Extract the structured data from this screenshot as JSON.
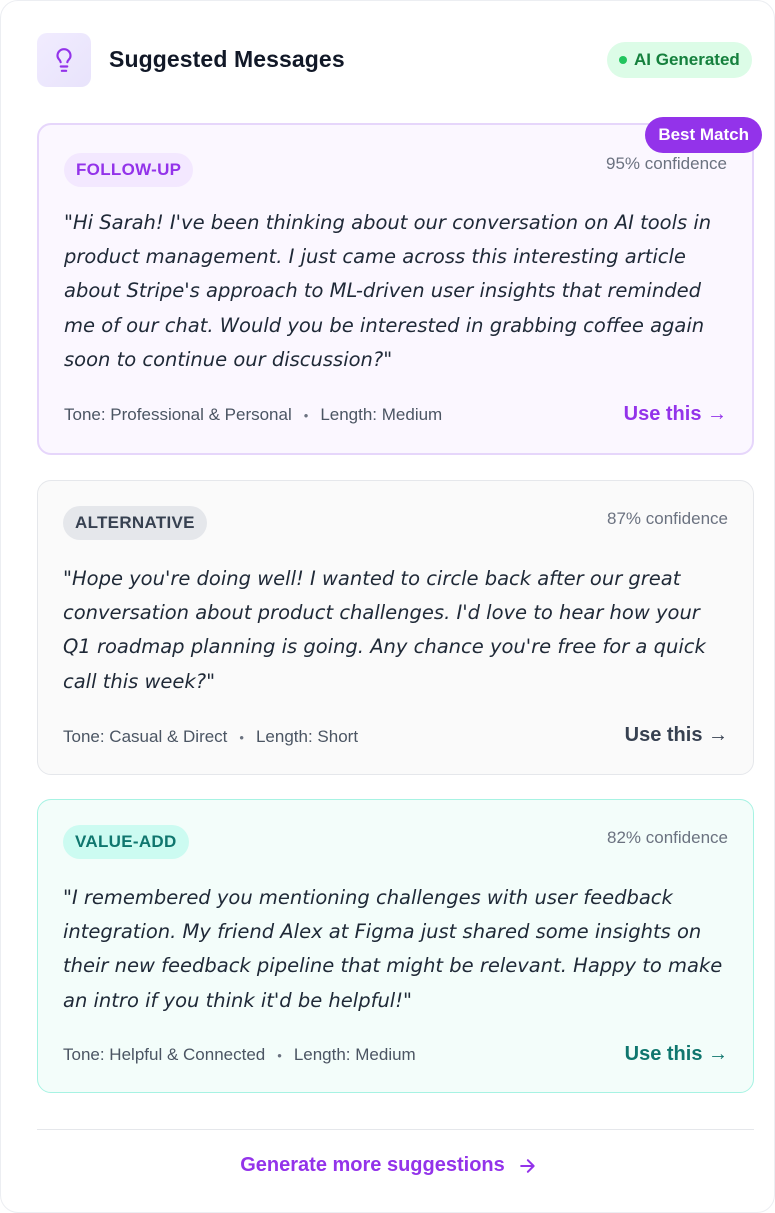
{
  "header": {
    "title": "Suggested Messages",
    "icon": "lightbulb-icon",
    "badge": "AI Generated",
    "accent": "#9333ea"
  },
  "suggestions": [
    {
      "tag": "FOLLOW-UP",
      "confidence": "95% confidence",
      "best_match_label": "Best Match",
      "message": "\"Hi Sarah! I've been thinking about our conversation on AI tools in product management. I just came across this interesting article about Stripe's approach to ML-driven user insights that reminded me of our chat. Would you be interested in grabbing coffee again soon to continue our discussion?\"",
      "tone": "Tone: Professional & Personal",
      "length": "Length: Medium",
      "action": "Use this →",
      "color": "#9333ea"
    },
    {
      "tag": "ALTERNATIVE",
      "confidence": "87% confidence",
      "message": "\"Hope you're doing well! I wanted to circle back after our great conversation about product challenges. I'd love to hear how your Q1 roadmap planning is going. Any chance you're free for a quick call this week?\"",
      "tone": "Tone: Casual & Direct",
      "length": "Length: Short",
      "action": "Use this →",
      "color": "#374151"
    },
    {
      "tag": "VALUE-ADD",
      "confidence": "82% confidence",
      "message": "\"I remembered you mentioning challenges with user feedback integration. My friend Alex at Figma just shared some insights on their new feedback pipeline that might be relevant. Happy to make an intro if you think it'd be helpful!\"",
      "tone": "Tone: Helpful & Connected",
      "length": "Length: Medium",
      "action": "Use this →",
      "color": "#0f766e"
    }
  ],
  "footer": {
    "generate_label": "Generate more suggestions",
    "arrow_icon": "arrow-right-icon"
  }
}
